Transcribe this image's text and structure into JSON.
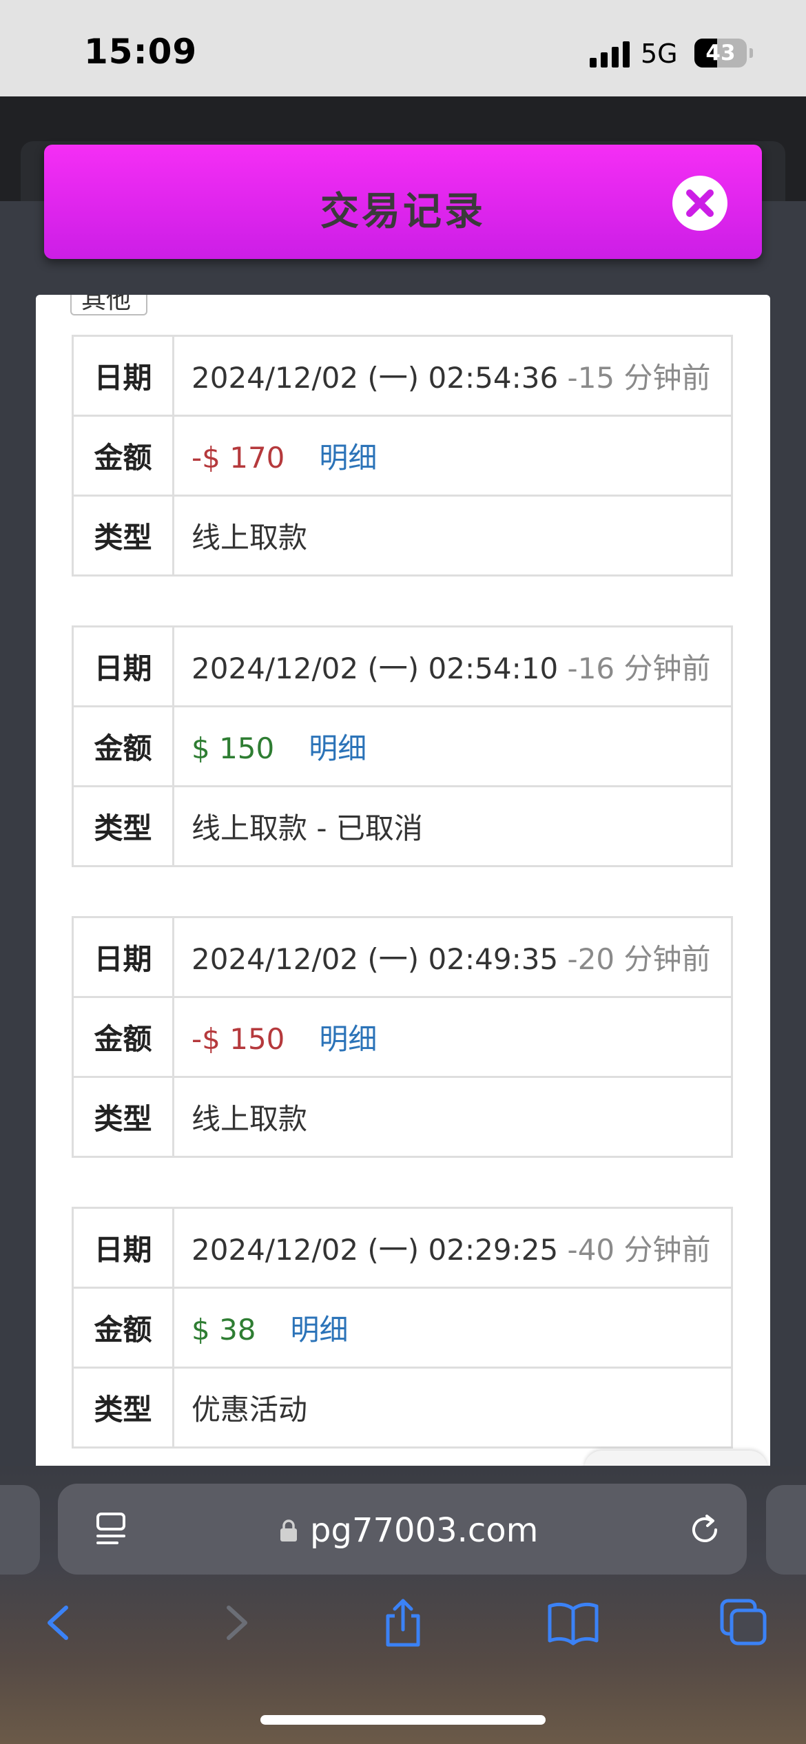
{
  "status_bar": {
    "time": "15:09",
    "network": "5G",
    "battery": "43",
    "battery_level": 0.43
  },
  "modal": {
    "title": "交易记录",
    "close_icon": "close-icon"
  },
  "filter": {
    "label": "其他"
  },
  "labels": {
    "date": "日期",
    "amount": "金额",
    "type": "类型",
    "detail": "明细"
  },
  "records": [
    {
      "date": "2024/12/02 (一) 02:54:36",
      "ago": "-15 分钟前",
      "amount": "-$ 170",
      "amount_sign": "negative",
      "type": "线上取款"
    },
    {
      "date": "2024/12/02 (一) 02:54:10",
      "ago": "-16 分钟前",
      "amount": "$ 150",
      "amount_sign": "positive",
      "type": "线上取款 - 已取消"
    },
    {
      "date": "2024/12/02 (一) 02:49:35",
      "ago": "-20 分钟前",
      "amount": "-$ 150",
      "amount_sign": "negative",
      "type": "线上取款"
    },
    {
      "date": "2024/12/02 (一) 02:29:25",
      "ago": "-40 分钟前",
      "amount": "$ 38",
      "amount_sign": "positive",
      "type": "优惠活动"
    }
  ],
  "browser": {
    "url": "pg77003.com"
  },
  "colors": {
    "header_gradient_top": "#f52ef5",
    "header_gradient_bottom": "#cc1ee6",
    "negative": "#b5393c",
    "positive": "#2e7d32",
    "link": "#2b73b8"
  }
}
